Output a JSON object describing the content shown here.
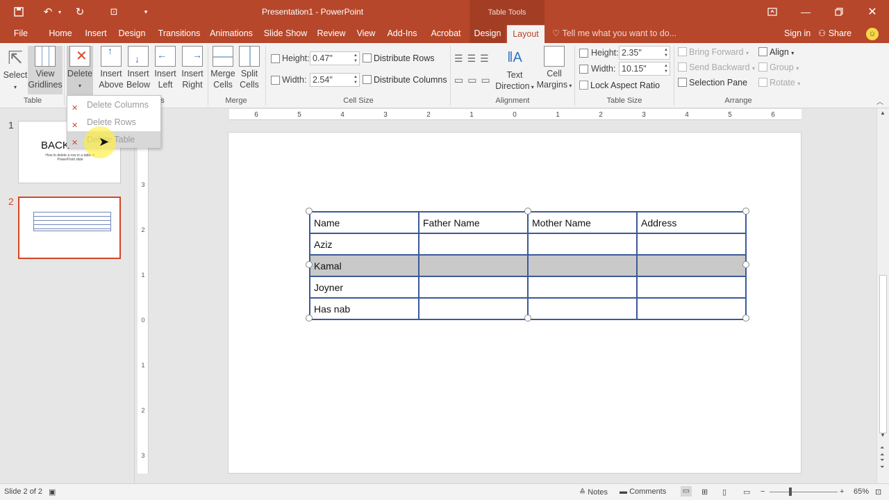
{
  "window": {
    "title": "Presentation1 - PowerPoint",
    "context_tab_group": "Table Tools"
  },
  "tabs": {
    "file": "File",
    "home": "Home",
    "insert": "Insert",
    "design": "Design",
    "transitions": "Transitions",
    "animations": "Animations",
    "slideshow": "Slide Show",
    "review": "Review",
    "view": "View",
    "addins": "Add-Ins",
    "acrobat": "Acrobat",
    "table_design": "Design",
    "layout": "Layout",
    "tell_me": "Tell me what you want to do...",
    "sign_in": "Sign in",
    "share": "Share"
  },
  "ribbon": {
    "select": "Select",
    "view_gridlines": [
      "View",
      "Gridlines"
    ],
    "delete": "Delete",
    "insert_above": [
      "Insert",
      "Above"
    ],
    "insert_below": [
      "Insert",
      "Below"
    ],
    "insert_left": [
      "Insert",
      "Left"
    ],
    "insert_right": [
      "Insert",
      "Right"
    ],
    "merge_cells": [
      "Merge",
      "Cells"
    ],
    "split_cells": [
      "Split",
      "Cells"
    ],
    "cell_height_label": "Height:",
    "cell_height_value": "0.47\"",
    "cell_width_label": "Width:",
    "cell_width_value": "2.54\"",
    "distribute_rows": "Distribute Rows",
    "distribute_columns": "Distribute Columns",
    "text_direction": [
      "Text",
      "Direction"
    ],
    "cell_margins": [
      "Cell",
      "Margins"
    ],
    "table_height_label": "Height:",
    "table_height_value": "2.35\"",
    "table_width_label": "Width:",
    "table_width_value": "10.15\"",
    "lock_aspect": "Lock Aspect Ratio",
    "bring_forward": "Bring Forward",
    "send_backward": "Send Backward",
    "selection_pane": "Selection Pane",
    "align": "Align",
    "group": "Group",
    "rotate": "Rotate",
    "groups": {
      "table": "Table",
      "rows_cols": "s",
      "merge": "Merge",
      "cell_size": "Cell Size",
      "alignment": "Alignment",
      "table_size": "Table Size",
      "arrange": "Arrange"
    }
  },
  "delete_menu": {
    "columns": "Delete Columns",
    "rows": "Delete Rows",
    "table": "Delete Table"
  },
  "thumbnails": {
    "slide1_num": "1",
    "slide1_title": "BACK",
    "slide1_subtitle": "How to delete a row in a table in PowerPoint slide",
    "slide2_num": "2"
  },
  "ruler": [
    "6",
    "5",
    "4",
    "3",
    "2",
    "1",
    "0",
    "1",
    "2",
    "3",
    "4",
    "5",
    "6"
  ],
  "table": {
    "header": [
      "Name",
      "Father Name",
      "Mother Name",
      "Address"
    ],
    "rows": [
      [
        "Aziz",
        "",
        "",
        ""
      ],
      [
        "Kamal",
        "",
        "",
        ""
      ],
      [
        "Joyner",
        "",
        "",
        ""
      ],
      [
        "Has nab",
        "",
        "",
        ""
      ]
    ],
    "selected_row": 2
  },
  "status": {
    "slide_info": "Slide 2 of 2",
    "notes": "Notes",
    "comments": "Comments",
    "zoom": "65%"
  }
}
